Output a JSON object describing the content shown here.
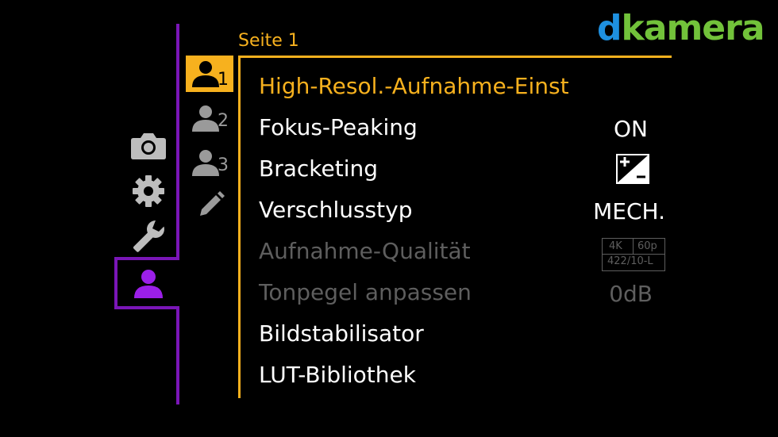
{
  "logo": {
    "prefix": "d",
    "name": "kamera"
  },
  "categories": [
    {
      "name": "camera",
      "icon": "camera-icon"
    },
    {
      "name": "settings",
      "icon": "gear-icon"
    },
    {
      "name": "setup",
      "icon": "wrench-icon"
    },
    {
      "name": "my-menu",
      "icon": "person-icon",
      "active": true
    }
  ],
  "subtabs": [
    {
      "number": "1",
      "active": true
    },
    {
      "number": "2"
    },
    {
      "number": "3"
    },
    {
      "number": "",
      "icon": "pencil-icon"
    }
  ],
  "page_label": "Seite 1",
  "menu": [
    {
      "label": "High-Resol.-Aufnahme-Einst",
      "value": "",
      "selected": true
    },
    {
      "label": "Fokus-Peaking",
      "value": "ON"
    },
    {
      "label": "Bracketing",
      "value": "",
      "value_icon": "exposure-bracket-icon"
    },
    {
      "label": "Verschlusstyp",
      "value": "MECH."
    },
    {
      "label": "Aufnahme-Qualität",
      "disabled": true,
      "quality": {
        "res": "4K",
        "fps": "60p",
        "codec": "422/10-L"
      }
    },
    {
      "label": "Tonpegel anpassen",
      "value": "0dB",
      "disabled": true
    },
    {
      "label": "Bildstabilisator",
      "value": ""
    },
    {
      "label": "LUT-Bibliothek",
      "value": ""
    }
  ],
  "colors": {
    "accent": "#f7b11e",
    "purple": "#7a16b7",
    "disabled": "#5e5e5e",
    "logo_d": "#1e90e0",
    "logo_kamera": "#72c23a"
  }
}
